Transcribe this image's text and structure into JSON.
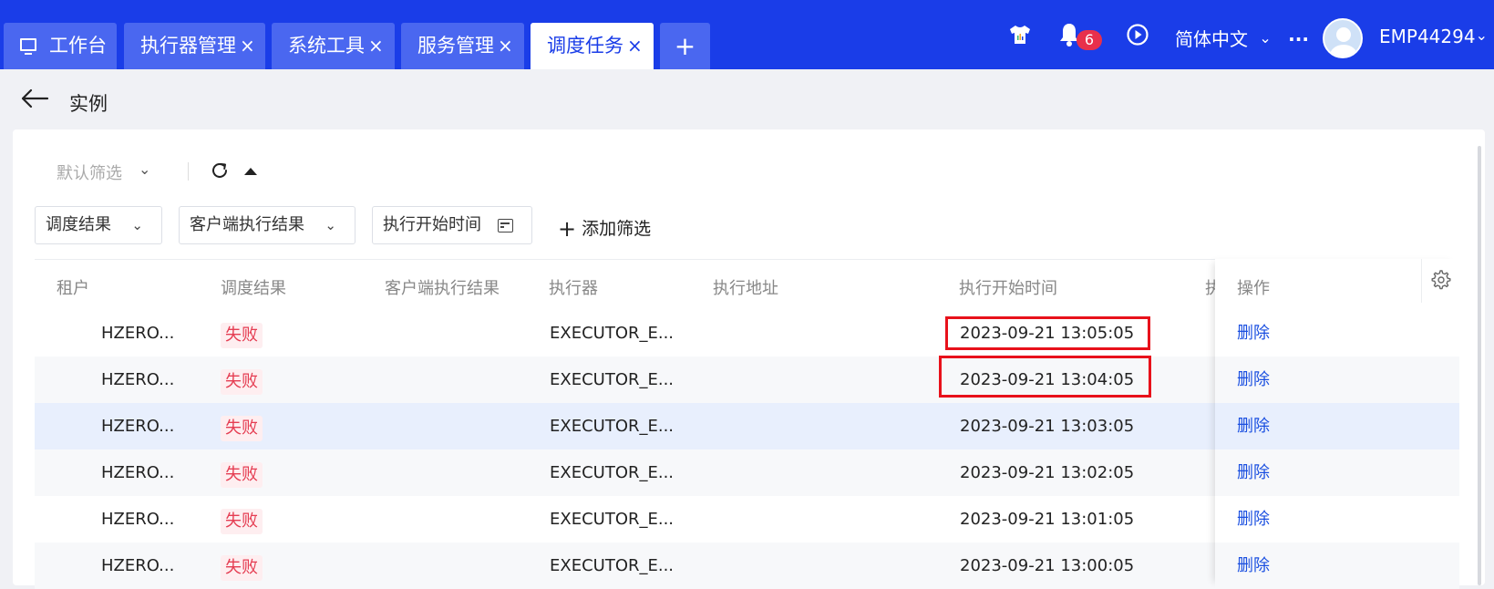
{
  "tabs": [
    {
      "label": "工作台",
      "active": false,
      "closable": false
    },
    {
      "label": "执行器管理",
      "active": false,
      "closable": true
    },
    {
      "label": "系统工具",
      "active": false,
      "closable": true
    },
    {
      "label": "服务管理",
      "active": false,
      "closable": true
    },
    {
      "label": "调度任务",
      "active": true,
      "closable": true
    }
  ],
  "tab_close_glyph": "×",
  "tab_add_glyph": "+",
  "topbar": {
    "notification_count": "6",
    "language": "简体中文",
    "language_caret": "⌄",
    "more": "···",
    "user": "EMP44294",
    "user_caret": "⌄",
    "icons": [
      "shirt-icon",
      "bell-icon",
      "play-circle-icon",
      "avatar"
    ]
  },
  "page": {
    "title": "实例"
  },
  "toolbar": {
    "preset_filter": "默认筛选",
    "preset_caret": "⌄"
  },
  "filters": {
    "dispatch_result": "调度结果",
    "client_result": "客户端执行结果",
    "start_time": "执行开始时间",
    "caret": "⌄",
    "add_filter": "添加筛选",
    "add_glyph": "+"
  },
  "table": {
    "columns": [
      "租户",
      "调度结果",
      "客户端执行结果",
      "执行器",
      "执行地址",
      "执行开始时间",
      "执",
      "操作"
    ],
    "rows": [
      {
        "tenant": "HZERO...",
        "dispatch_result": "失败",
        "client_result": "",
        "executor": "EXECUTOR_E...",
        "address": "",
        "start_time": "2023-09-21 13:05:05",
        "action": "删除"
      },
      {
        "tenant": "HZERO...",
        "dispatch_result": "失败",
        "client_result": "",
        "executor": "EXECUTOR_E...",
        "address": "",
        "start_time": "2023-09-21 13:04:05",
        "action": "删除"
      },
      {
        "tenant": "HZERO...",
        "dispatch_result": "失败",
        "client_result": "",
        "executor": "EXECUTOR_E...",
        "address": "",
        "start_time": "2023-09-21 13:03:05",
        "action": "删除"
      },
      {
        "tenant": "HZERO...",
        "dispatch_result": "失败",
        "client_result": "",
        "executor": "EXECUTOR_E...",
        "address": "",
        "start_time": "2023-09-21 13:02:05",
        "action": "删除"
      },
      {
        "tenant": "HZERO...",
        "dispatch_result": "失败",
        "client_result": "",
        "executor": "EXECUTOR_E...",
        "address": "",
        "start_time": "2023-09-21 13:01:05",
        "action": "删除"
      },
      {
        "tenant": "HZERO...",
        "dispatch_result": "失败",
        "client_result": "",
        "executor": "EXECUTOR_E...",
        "address": "",
        "start_time": "2023-09-21 13:00:05",
        "action": "删除"
      }
    ],
    "selected_row": 2,
    "highlighted_cells": [
      0,
      1
    ]
  },
  "colors": {
    "brand": "#1a3de8",
    "tag_fail_text": "#e53d52",
    "tag_fail_bg": "#feeef0",
    "link": "#1a4fe0",
    "highlight_box": "#e8111b",
    "selected_row_bg": "#e8effd"
  }
}
